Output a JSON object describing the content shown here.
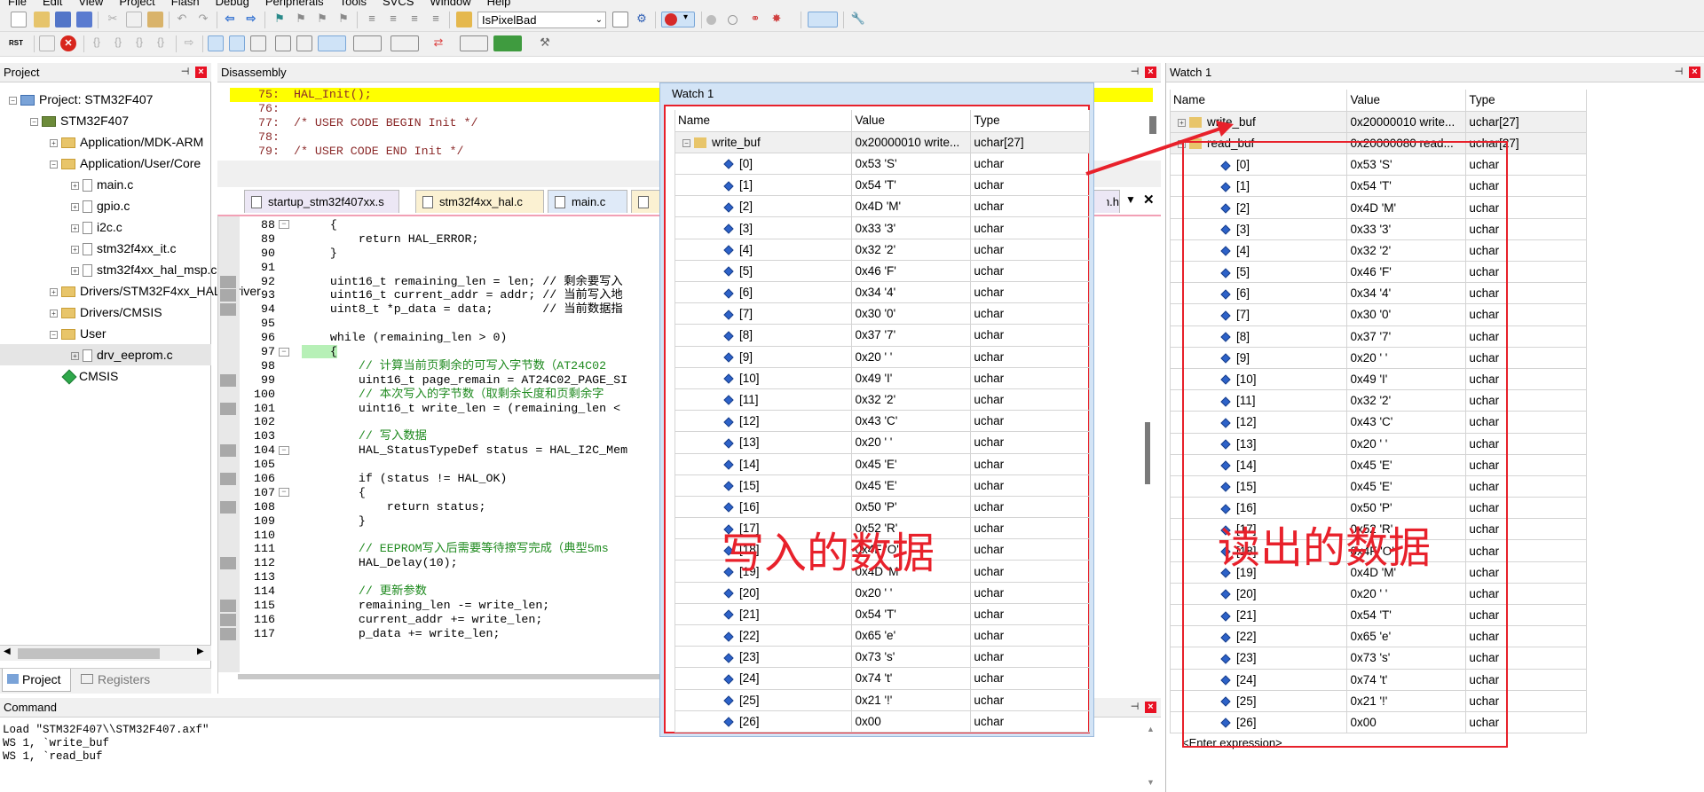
{
  "menu": [
    "File",
    "Edit",
    "View",
    "Project",
    "Flash",
    "Debug",
    "Peripherals",
    "Tools",
    "SVCS",
    "Window",
    "Help"
  ],
  "toolbar": {
    "target_combo": "IsPixelBad"
  },
  "project": {
    "title": "Project",
    "root": "Project: STM32F407",
    "target": "STM32F407",
    "items": [
      "Application/MDK-ARM",
      "Application/User/Core",
      "main.c",
      "gpio.c",
      "i2c.c",
      "stm32f4xx_it.c",
      "stm32f4xx_hal_msp.c",
      "Drivers/STM32F4xx_HAL_Driver",
      "Drivers/CMSIS",
      "User",
      "drv_eeprom.c",
      "CMSIS"
    ],
    "tab_project": "Project",
    "tab_registers": "Registers"
  },
  "disasm": {
    "title": "Disassembly",
    "lines": [
      {
        "n": "75:",
        "c": "  HAL_Init();"
      },
      {
        "n": "76:",
        "c": ""
      },
      {
        "n": "77:",
        "c": "  /* USER CODE BEGIN Init */"
      },
      {
        "n": "78:",
        "c": ""
      },
      {
        "n": "79:",
        "c": "  /* USER CODE END Init */"
      }
    ]
  },
  "tabs": [
    "startup_stm32f407xx.s",
    "stm32f4xx_hal.c",
    "main.c",
    "",
    "drv_eeprom.h"
  ],
  "code": [
    {
      "n": "88",
      "c": "    {"
    },
    {
      "n": "89",
      "c": "        return HAL_ERROR;"
    },
    {
      "n": "90",
      "c": "    }"
    },
    {
      "n": "91",
      "c": ""
    },
    {
      "n": "92",
      "c": "    uint16_t remaining_len = len; // 剩余要写入"
    },
    {
      "n": "93",
      "c": "    uint16_t current_addr = addr; // 当前写入地"
    },
    {
      "n": "94",
      "c": "    uint8_t *p_data = data;       // 当前数据指"
    },
    {
      "n": "95",
      "c": ""
    },
    {
      "n": "96",
      "c": "    while (remaining_len > 0)"
    },
    {
      "n": "97",
      "c": "    {"
    },
    {
      "n": "98",
      "c": "        // 计算当前页剩余的可写入字节数（AT24C02"
    },
    {
      "n": "99",
      "c": "        uint16_t page_remain = AT24C02_PAGE_SI"
    },
    {
      "n": "100",
      "c": "        // 本次写入的字节数（取剩余长度和页剩余字"
    },
    {
      "n": "101",
      "c": "        uint16_t write_len = (remaining_len <"
    },
    {
      "n": "102",
      "c": ""
    },
    {
      "n": "103",
      "c": "        // 写入数据"
    },
    {
      "n": "104",
      "c": "        HAL_StatusTypeDef status = HAL_I2C_Mem"
    },
    {
      "n": "105",
      "c": ""
    },
    {
      "n": "106",
      "c": "        if (status != HAL_OK)"
    },
    {
      "n": "107",
      "c": "        {"
    },
    {
      "n": "108",
      "c": "            return status;"
    },
    {
      "n": "109",
      "c": "        }"
    },
    {
      "n": "110",
      "c": ""
    },
    {
      "n": "111",
      "c": "        // EEPROM写入后需要等待擦写完成（典型5ms"
    },
    {
      "n": "112",
      "c": "        HAL_Delay(10);"
    },
    {
      "n": "113",
      "c": ""
    },
    {
      "n": "114",
      "c": "        // 更新参数"
    },
    {
      "n": "115",
      "c": "        remaining_len -= write_len;"
    },
    {
      "n": "116",
      "c": "        current_addr += write_len;"
    },
    {
      "n": "117",
      "c": "        p_data += write_len;"
    }
  ],
  "watch_float": {
    "title": "Watch 1",
    "cols": [
      "Name",
      "Value",
      "Type"
    ],
    "root": {
      "name": "write_buf",
      "value": "0x20000010 write...",
      "type": "uchar[27]"
    }
  },
  "watch_dock": {
    "title": "Watch 1",
    "cols": [
      "Name",
      "Value",
      "Type"
    ],
    "row0": {
      "name": "write_buf",
      "value": "0x20000010 write...",
      "type": "uchar[27]"
    },
    "row1": {
      "name": "read_buf",
      "value": "0x20000080 read...",
      "type": "uchar[27]"
    },
    "enter": "<Enter expression>"
  },
  "elements": [
    {
      "i": "[0]",
      "v": "0x53 'S'",
      "t": "uchar"
    },
    {
      "i": "[1]",
      "v": "0x54 'T'",
      "t": "uchar"
    },
    {
      "i": "[2]",
      "v": "0x4D 'M'",
      "t": "uchar"
    },
    {
      "i": "[3]",
      "v": "0x33 '3'",
      "t": "uchar"
    },
    {
      "i": "[4]",
      "v": "0x32 '2'",
      "t": "uchar"
    },
    {
      "i": "[5]",
      "v": "0x46 'F'",
      "t": "uchar"
    },
    {
      "i": "[6]",
      "v": "0x34 '4'",
      "t": "uchar"
    },
    {
      "i": "[7]",
      "v": "0x30 '0'",
      "t": "uchar"
    },
    {
      "i": "[8]",
      "v": "0x37 '7'",
      "t": "uchar"
    },
    {
      "i": "[9]",
      "v": "0x20 ' '",
      "t": "uchar"
    },
    {
      "i": "[10]",
      "v": "0x49 'I'",
      "t": "uchar"
    },
    {
      "i": "[11]",
      "v": "0x32 '2'",
      "t": "uchar"
    },
    {
      "i": "[12]",
      "v": "0x43 'C'",
      "t": "uchar"
    },
    {
      "i": "[13]",
      "v": "0x20 ' '",
      "t": "uchar"
    },
    {
      "i": "[14]",
      "v": "0x45 'E'",
      "t": "uchar"
    },
    {
      "i": "[15]",
      "v": "0x45 'E'",
      "t": "uchar"
    },
    {
      "i": "[16]",
      "v": "0x50 'P'",
      "t": "uchar"
    },
    {
      "i": "[17]",
      "v": "0x52 'R'",
      "t": "uchar"
    },
    {
      "i": "[18]",
      "v": "0x4F 'O'",
      "t": "uchar"
    },
    {
      "i": "[19]",
      "v": "0x4D 'M'",
      "t": "uchar"
    },
    {
      "i": "[20]",
      "v": "0x20 ' '",
      "t": "uchar"
    },
    {
      "i": "[21]",
      "v": "0x54 'T'",
      "t": "uchar"
    },
    {
      "i": "[22]",
      "v": "0x65 'e'",
      "t": "uchar"
    },
    {
      "i": "[23]",
      "v": "0x73 's'",
      "t": "uchar"
    },
    {
      "i": "[24]",
      "v": "0x74 't'",
      "t": "uchar"
    },
    {
      "i": "[25]",
      "v": "0x21 '!'",
      "t": "uchar"
    },
    {
      "i": "[26]",
      "v": "0x00",
      "t": "uchar"
    }
  ],
  "command": {
    "title": "Command",
    "lines": [
      "Load \"STM32F407\\\\STM32F407.axf\"",
      "WS 1, `write_buf",
      "WS 1, `read_buf"
    ]
  },
  "annotations": {
    "written": "写入的数据",
    "read": "读出的数据"
  },
  "colors": {
    "annotation_red": "#e8212b",
    "highlight_yellow": "#ffff00",
    "panel_bg": "#f0f0f0"
  }
}
